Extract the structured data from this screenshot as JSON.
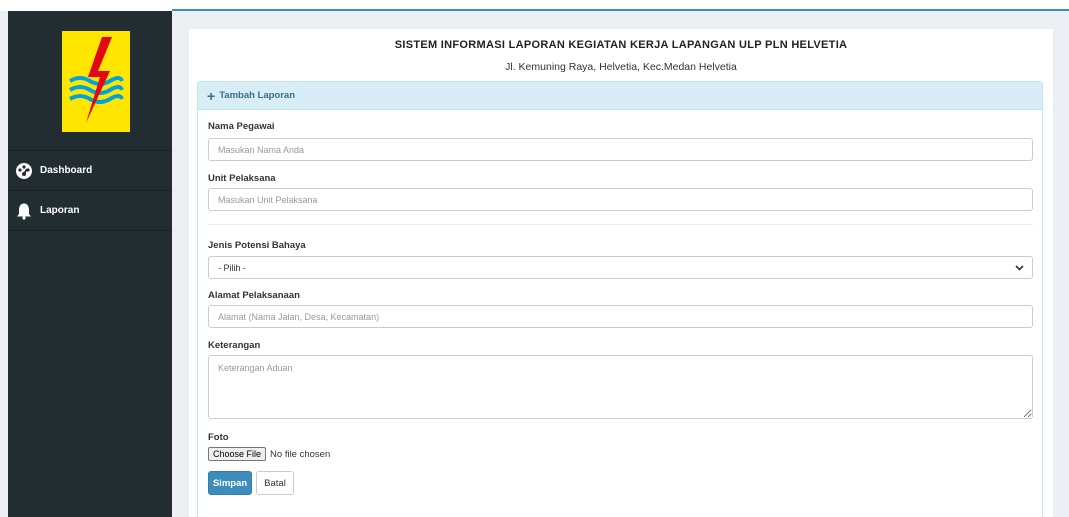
{
  "colors": {
    "sidebar_bg": "#222d32",
    "accent": "#3c8dbc",
    "panel_heading_bg": "#d9edf7",
    "panel_heading_text": "#31708f",
    "logo_yellow": "#ffe600",
    "logo_red": "#e30613",
    "logo_blue": "#00a3e0"
  },
  "sidebar": {
    "logo_icon": "pln-logo",
    "items": [
      {
        "label": "Dashboard",
        "icon": "dashboard-icon"
      },
      {
        "label": "Laporan",
        "icon": "bell-icon"
      }
    ]
  },
  "header": {
    "title": "SISTEM INFORMASI LAPORAN KEGIATAN KERJA LAPANGAN ULP PLN HELVETIA",
    "subtitle": "Jl. Kemuning Raya, Helvetia, Kec.Medan Helvetia"
  },
  "form": {
    "heading": "Tambah Laporan",
    "nama_label": "Nama Pegawai",
    "nama_placeholder": "Masukan Nama Anda",
    "unit_label": "Unit Pelaksana",
    "unit_placeholder": "Masukan Unit Pelaksana",
    "jenis_label": "Jenis Potensi Bahaya",
    "jenis_selected": "- Pilih -",
    "alamat_label": "Alamat Pelaksanaan",
    "alamat_placeholder": "Alamat (Nama Jalan, Desa, Kecamatan)",
    "keterangan_label": "Keterangan",
    "keterangan_placeholder": "Keterangan Aduan",
    "foto_label": "Foto",
    "file_button": "Choose File",
    "file_status": "No file chosen",
    "save_label": "Simpan",
    "cancel_label": "Batal"
  }
}
